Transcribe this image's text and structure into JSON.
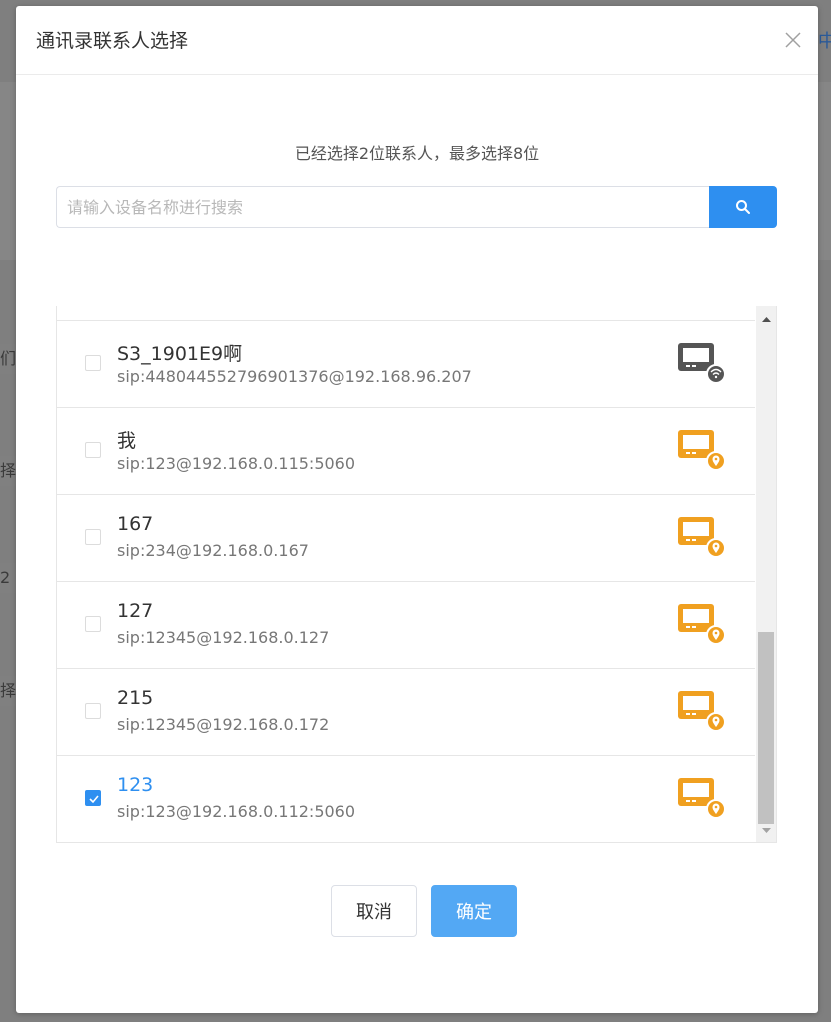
{
  "background": {
    "right_edge_text": "中",
    "left_edge_texts": [
      "们",
      "择",
      "2",
      "择"
    ]
  },
  "dialog": {
    "title": "通讯录联系人选择",
    "hint": "已经选择2位联系人，最多选择8位",
    "search": {
      "placeholder": "请输入设备名称进行搜索",
      "value": ""
    },
    "contacts": [
      {
        "name": "S3_1901E9啊",
        "sip": "sip:448044552796901376@192.168.96.207",
        "checked": false,
        "icon": "wifi-terminal-icon",
        "icon_color": "#555555"
      },
      {
        "name": "我",
        "sip": "sip:123@192.168.0.115:5060",
        "checked": false,
        "icon": "location-terminal-icon",
        "icon_color": "#f0a020"
      },
      {
        "name": "167",
        "sip": "sip:234@192.168.0.167",
        "checked": false,
        "icon": "location-terminal-icon",
        "icon_color": "#f0a020"
      },
      {
        "name": "127",
        "sip": "sip:12345@192.168.0.127",
        "checked": false,
        "icon": "location-terminal-icon",
        "icon_color": "#f0a020"
      },
      {
        "name": "215",
        "sip": "sip:12345@192.168.0.172",
        "checked": false,
        "icon": "location-terminal-icon",
        "icon_color": "#f0a020"
      },
      {
        "name": "123",
        "sip": "sip:123@192.168.0.112:5060",
        "checked": true,
        "icon": "location-terminal-icon",
        "icon_color": "#f0a020"
      }
    ],
    "buttons": {
      "cancel": "取消",
      "ok": "确定"
    },
    "accent_color": "#2e8ff0"
  }
}
